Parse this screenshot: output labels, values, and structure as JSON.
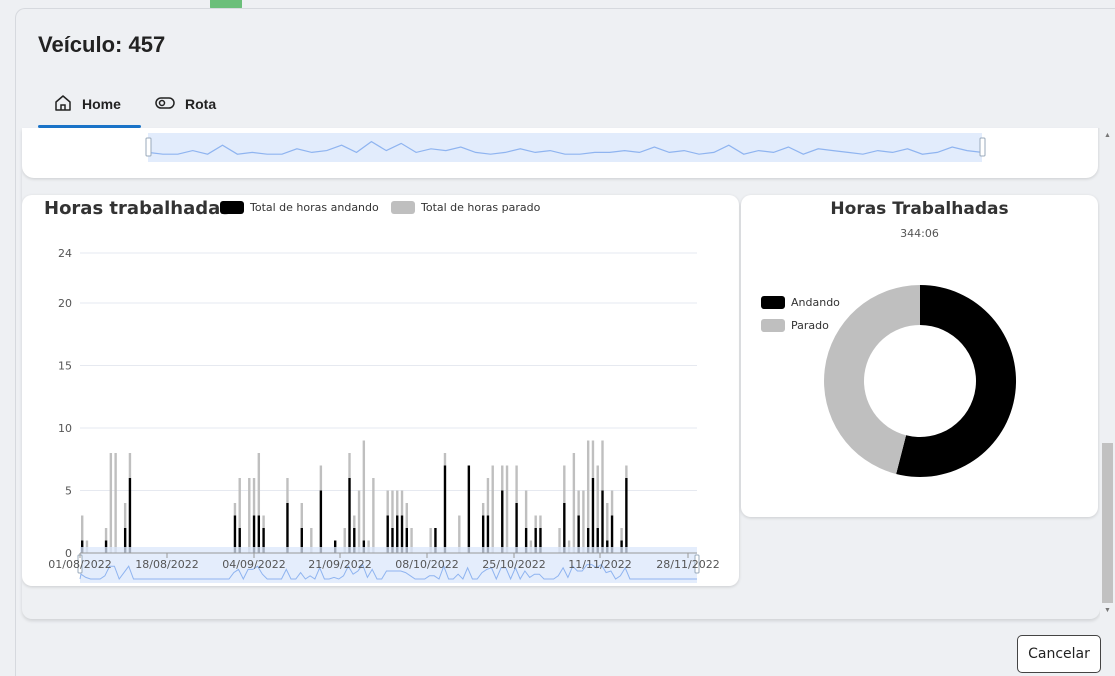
{
  "header": {
    "title": "Veículo: 457"
  },
  "tabs": [
    {
      "label": "Home",
      "icon": "home-icon",
      "active": true
    },
    {
      "label": "Rota",
      "icon": "toggle-icon",
      "active": false
    }
  ],
  "bar_chart": {
    "title": "Horas trabalhadas",
    "legend": [
      {
        "label": "Total de horas andando",
        "color": "#000000"
      },
      {
        "label": "Total de horas parado",
        "color": "#bfbfbf"
      }
    ]
  },
  "pie_chart": {
    "title": "Horas Trabalhadas",
    "subtitle": "344:06",
    "legend": [
      {
        "label": "Andando",
        "color": "#000000"
      },
      {
        "label": "Parado",
        "color": "#bfbfbf"
      }
    ]
  },
  "buttons": {
    "cancel_label": "Cancelar"
  },
  "colors": {
    "accent": "#1a73c8",
    "andando": "#000000",
    "parado": "#bfbfbf",
    "zoom_fill": "#dbe7fb",
    "zoom_line": "#8fb4f0"
  },
  "chart_data": [
    {
      "type": "bar",
      "stacked": true,
      "title": "Horas trabalhadas",
      "x_range": [
        "01/08/2022",
        "07/12/2022"
      ],
      "x_tick_labels": [
        "01/08/2022",
        "18/08/2022",
        "04/09/2022",
        "21/09/2022",
        "08/10/2022",
        "25/10/2022",
        "11/11/2022",
        "28/11/2022"
      ],
      "y_ticks": [
        0,
        5,
        10,
        15,
        20,
        24
      ],
      "ylim": [
        0,
        24
      ],
      "grid": true,
      "legend_position": "top",
      "x": [
        0,
        1,
        5,
        6,
        7,
        9,
        10,
        32,
        33,
        35,
        36,
        37,
        38,
        43,
        46,
        48,
        50,
        53,
        55,
        56,
        57,
        58,
        59,
        60,
        61,
        64,
        65,
        66,
        67,
        68,
        69,
        73,
        74,
        76,
        79,
        81,
        84,
        85,
        86,
        88,
        89,
        91,
        93,
        94,
        95,
        96,
        100,
        101,
        102,
        103,
        104,
        105,
        106,
        107,
        108,
        109,
        110,
        111,
        113,
        114
      ],
      "series": [
        {
          "name": "Total de horas andando",
          "values": [
            1,
            0,
            1,
            0,
            0,
            2,
            6,
            3,
            2,
            0,
            3,
            3,
            2,
            4,
            2,
            0,
            5,
            1,
            0,
            6,
            2,
            0,
            1,
            0,
            0,
            3,
            2,
            3,
            3,
            2,
            0,
            0,
            2,
            7,
            0,
            7,
            3,
            3,
            0,
            5,
            0,
            4,
            2,
            0,
            2,
            2,
            0,
            4,
            0,
            0,
            3,
            0,
            2,
            6,
            2,
            5,
            1,
            3,
            1,
            6
          ]
        },
        {
          "name": "Total de horas parado",
          "values": [
            2,
            1,
            1,
            8,
            8,
            2,
            2,
            1,
            4,
            6,
            3,
            5,
            1,
            2,
            2,
            2,
            2,
            0,
            2,
            2,
            1,
            5,
            8,
            1,
            6,
            2,
            3,
            2,
            2,
            2,
            2,
            2,
            0,
            1,
            3,
            0,
            1,
            3,
            7,
            2,
            7,
            3,
            3,
            1,
            1,
            1,
            2,
            3,
            1,
            8,
            2,
            5,
            7,
            3,
            5,
            4,
            3,
            2,
            1,
            1
          ]
        }
      ]
    },
    {
      "type": "pie",
      "title": "Horas Trabalhadas",
      "subtitle": "344:06",
      "donut": true,
      "labels": [
        "Andando",
        "Parado"
      ],
      "values": [
        54,
        46
      ],
      "legend_position": "left"
    }
  ]
}
